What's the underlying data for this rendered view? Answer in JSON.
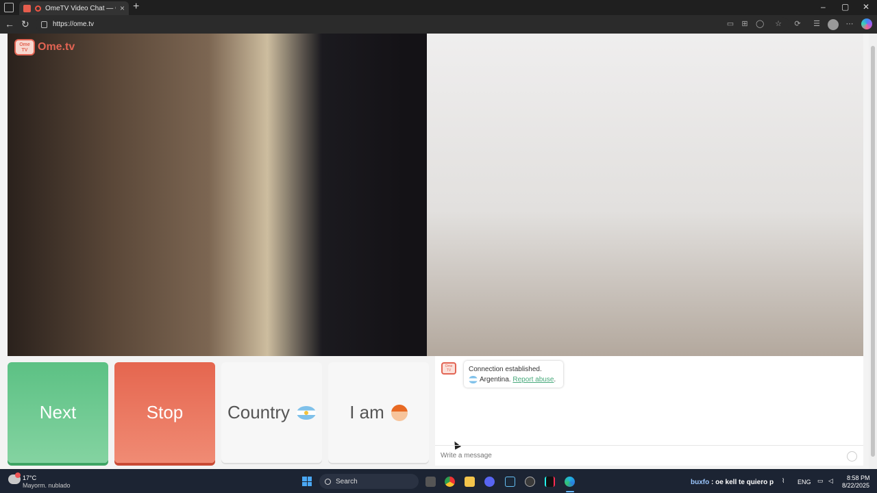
{
  "browser": {
    "tab_title": "OmeTV Video Chat — Ome",
    "tab_close": "×",
    "new_tab": "+",
    "url": "https://ome.tv",
    "window_controls": {
      "minimize": "–",
      "maximize": "▢",
      "close": "✕"
    }
  },
  "site": {
    "logo_badge": "Ome TV",
    "logo_text": "Ome.tv"
  },
  "controls": {
    "next_label": "Next",
    "stop_label": "Stop",
    "country_label": "Country",
    "iam_label": "I am"
  },
  "chat": {
    "logo_badge": "Ome TV",
    "connection_text": "Connection established.",
    "country_text": "Argentina.",
    "report_link": "Report abuse",
    "report_suffix": ".",
    "input_placeholder": "Write a message"
  },
  "taskbar": {
    "temperature": "17°C",
    "weather": "Mayorm. nublado",
    "search_label": "Search",
    "notification_user": "buxfo",
    "notification_text": ": oe kell te quiero p",
    "language": "ENG",
    "time": "8:58 PM",
    "date": "8/22/2025"
  },
  "colors": {
    "next": "#5cc184",
    "stop": "#e5664f",
    "brand": "#e26453",
    "link": "#46a87a"
  }
}
